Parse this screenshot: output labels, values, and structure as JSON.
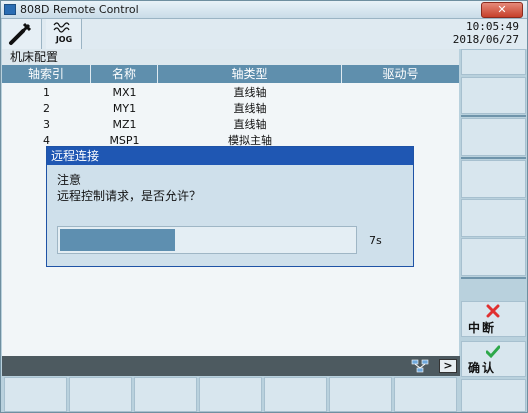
{
  "window": {
    "title": "808D Remote Control",
    "close_label": "✕"
  },
  "header": {
    "jog_label": "JOG",
    "time": "10:05:49",
    "date": "2018/06/27"
  },
  "screen": {
    "title": "机床配置"
  },
  "table": {
    "columns": [
      "轴索引",
      "名称",
      "轴类型",
      "驱动号"
    ],
    "rows": [
      {
        "index": "1",
        "name": "MX1",
        "type": "直线轴",
        "drive": ""
      },
      {
        "index": "2",
        "name": "MY1",
        "type": "直线轴",
        "drive": ""
      },
      {
        "index": "3",
        "name": "MZ1",
        "type": "直线轴",
        "drive": ""
      },
      {
        "index": "4",
        "name": "MSP1",
        "type": "模拟主轴",
        "drive": ""
      }
    ]
  },
  "dialog": {
    "title": "远程连接",
    "heading": "注意",
    "message": "远程控制请求，是否允许？",
    "progress_fraction": 0.39,
    "countdown": "7s"
  },
  "softkeys_right": {
    "abort_label": "中断",
    "confirm_label": "确认"
  },
  "statusbar": {
    "nav_label": ">"
  },
  "colors": {
    "accent": "#1f57b3",
    "abort": "#e03030",
    "confirm": "#2ea84a"
  },
  "icons": {
    "settings": "wrench-icon",
    "mode": "jog-mode-icon",
    "network": "network-icon",
    "abort": "cross-icon",
    "confirm": "checkmark-icon"
  }
}
